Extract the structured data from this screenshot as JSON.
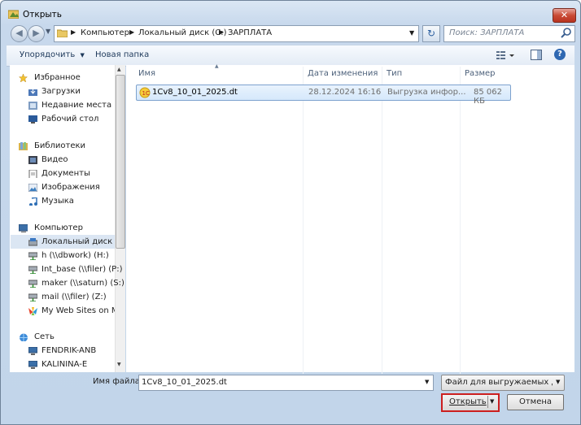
{
  "window": {
    "title": "Открыть"
  },
  "address": {
    "crumbs": [
      "Компьютер",
      "Локальный диск (C:)",
      "ЗАРПЛАТА"
    ],
    "search_placeholder": "Поиск: ЗАРПЛАТА"
  },
  "toolbar": {
    "organize_label": "Упорядочить",
    "new_folder_label": "Новая папка"
  },
  "navpane": {
    "groups": [
      {
        "label": "Избранное",
        "items": [
          "Загрузки",
          "Недавние места",
          "Рабочий стол"
        ]
      },
      {
        "label": "Библиотеки",
        "items": [
          "Видео",
          "Документы",
          "Изображения",
          "Музыка"
        ]
      },
      {
        "label": "Компьютер",
        "items": [
          "Локальный диск (C:)",
          "h (\\\\dbwork) (H:)",
          "Int_base (\\\\filer) (P:)",
          "maker (\\\\saturn) (S:)",
          "mail (\\\\filer) (Z:)",
          "My Web Sites on MSN"
        ]
      },
      {
        "label": "Сеть",
        "items": [
          "FENDRIK-ANB",
          "KALININA-E"
        ]
      }
    ]
  },
  "filelist": {
    "columns": [
      "Имя",
      "Дата изменения",
      "Тип",
      "Размер"
    ],
    "rows": [
      {
        "name": "1Cv8_10_01_2025.dt",
        "date": "28.12.2024 16:16",
        "type": "Выгрузка инфор...",
        "size": "85 062 КБ"
      }
    ]
  },
  "bottom": {
    "filename_label": "Имя файла:",
    "filename_value": "1Cv8_10_01_2025.dt",
    "filetype_value": "Файл для выгружаемых данн",
    "open_label": "Открыть",
    "cancel_label": "Отмена"
  }
}
